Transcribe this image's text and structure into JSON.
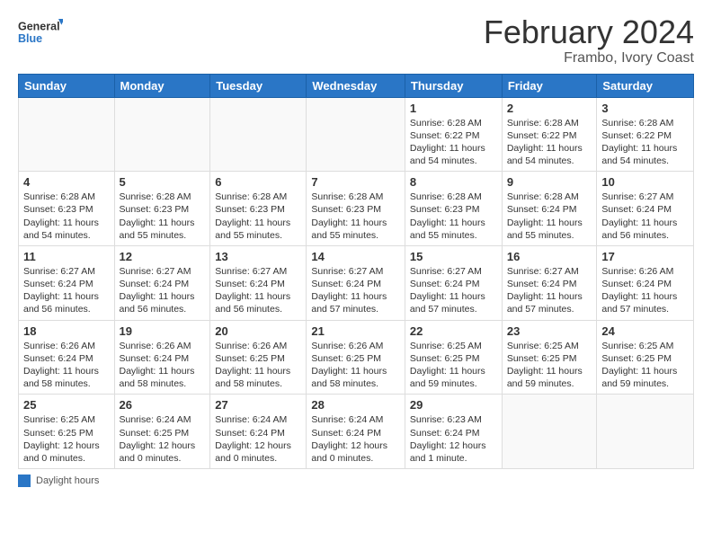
{
  "logo": {
    "line1": "General",
    "line2": "Blue"
  },
  "title": "February 2024",
  "subtitle": "Frambo, Ivory Coast",
  "days_of_week": [
    "Sunday",
    "Monday",
    "Tuesday",
    "Wednesday",
    "Thursday",
    "Friday",
    "Saturday"
  ],
  "weeks": [
    [
      {
        "day": "",
        "info": ""
      },
      {
        "day": "",
        "info": ""
      },
      {
        "day": "",
        "info": ""
      },
      {
        "day": "",
        "info": ""
      },
      {
        "day": "1",
        "info": "Sunrise: 6:28 AM\nSunset: 6:22 PM\nDaylight: 11 hours and 54 minutes."
      },
      {
        "day": "2",
        "info": "Sunrise: 6:28 AM\nSunset: 6:22 PM\nDaylight: 11 hours and 54 minutes."
      },
      {
        "day": "3",
        "info": "Sunrise: 6:28 AM\nSunset: 6:22 PM\nDaylight: 11 hours and 54 minutes."
      }
    ],
    [
      {
        "day": "4",
        "info": "Sunrise: 6:28 AM\nSunset: 6:23 PM\nDaylight: 11 hours and 54 minutes."
      },
      {
        "day": "5",
        "info": "Sunrise: 6:28 AM\nSunset: 6:23 PM\nDaylight: 11 hours and 55 minutes."
      },
      {
        "day": "6",
        "info": "Sunrise: 6:28 AM\nSunset: 6:23 PM\nDaylight: 11 hours and 55 minutes."
      },
      {
        "day": "7",
        "info": "Sunrise: 6:28 AM\nSunset: 6:23 PM\nDaylight: 11 hours and 55 minutes."
      },
      {
        "day": "8",
        "info": "Sunrise: 6:28 AM\nSunset: 6:23 PM\nDaylight: 11 hours and 55 minutes."
      },
      {
        "day": "9",
        "info": "Sunrise: 6:28 AM\nSunset: 6:24 PM\nDaylight: 11 hours and 55 minutes."
      },
      {
        "day": "10",
        "info": "Sunrise: 6:27 AM\nSunset: 6:24 PM\nDaylight: 11 hours and 56 minutes."
      }
    ],
    [
      {
        "day": "11",
        "info": "Sunrise: 6:27 AM\nSunset: 6:24 PM\nDaylight: 11 hours and 56 minutes."
      },
      {
        "day": "12",
        "info": "Sunrise: 6:27 AM\nSunset: 6:24 PM\nDaylight: 11 hours and 56 minutes."
      },
      {
        "day": "13",
        "info": "Sunrise: 6:27 AM\nSunset: 6:24 PM\nDaylight: 11 hours and 56 minutes."
      },
      {
        "day": "14",
        "info": "Sunrise: 6:27 AM\nSunset: 6:24 PM\nDaylight: 11 hours and 57 minutes."
      },
      {
        "day": "15",
        "info": "Sunrise: 6:27 AM\nSunset: 6:24 PM\nDaylight: 11 hours and 57 minutes."
      },
      {
        "day": "16",
        "info": "Sunrise: 6:27 AM\nSunset: 6:24 PM\nDaylight: 11 hours and 57 minutes."
      },
      {
        "day": "17",
        "info": "Sunrise: 6:26 AM\nSunset: 6:24 PM\nDaylight: 11 hours and 57 minutes."
      }
    ],
    [
      {
        "day": "18",
        "info": "Sunrise: 6:26 AM\nSunset: 6:24 PM\nDaylight: 11 hours and 58 minutes."
      },
      {
        "day": "19",
        "info": "Sunrise: 6:26 AM\nSunset: 6:24 PM\nDaylight: 11 hours and 58 minutes."
      },
      {
        "day": "20",
        "info": "Sunrise: 6:26 AM\nSunset: 6:25 PM\nDaylight: 11 hours and 58 minutes."
      },
      {
        "day": "21",
        "info": "Sunrise: 6:26 AM\nSunset: 6:25 PM\nDaylight: 11 hours and 58 minutes."
      },
      {
        "day": "22",
        "info": "Sunrise: 6:25 AM\nSunset: 6:25 PM\nDaylight: 11 hours and 59 minutes."
      },
      {
        "day": "23",
        "info": "Sunrise: 6:25 AM\nSunset: 6:25 PM\nDaylight: 11 hours and 59 minutes."
      },
      {
        "day": "24",
        "info": "Sunrise: 6:25 AM\nSunset: 6:25 PM\nDaylight: 11 hours and 59 minutes."
      }
    ],
    [
      {
        "day": "25",
        "info": "Sunrise: 6:25 AM\nSunset: 6:25 PM\nDaylight: 12 hours and 0 minutes."
      },
      {
        "day": "26",
        "info": "Sunrise: 6:24 AM\nSunset: 6:25 PM\nDaylight: 12 hours and 0 minutes."
      },
      {
        "day": "27",
        "info": "Sunrise: 6:24 AM\nSunset: 6:24 PM\nDaylight: 12 hours and 0 minutes."
      },
      {
        "day": "28",
        "info": "Sunrise: 6:24 AM\nSunset: 6:24 PM\nDaylight: 12 hours and 0 minutes."
      },
      {
        "day": "29",
        "info": "Sunrise: 6:23 AM\nSunset: 6:24 PM\nDaylight: 12 hours and 1 minute."
      },
      {
        "day": "",
        "info": ""
      },
      {
        "day": "",
        "info": ""
      }
    ]
  ],
  "footer": {
    "box_label": "Daylight hours"
  }
}
